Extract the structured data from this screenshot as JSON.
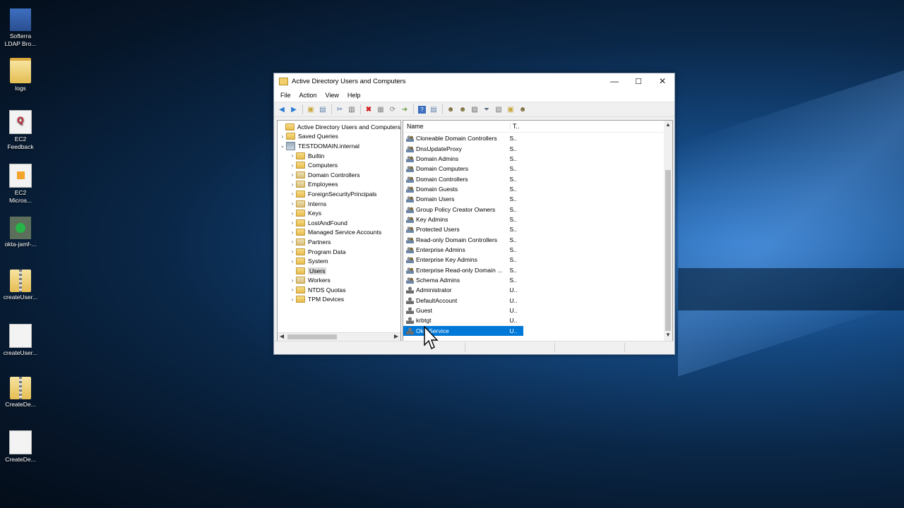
{
  "desktop_icons": [
    {
      "label": "Softerra LDAP Bro...",
      "icon": "ldap-browser-icon"
    },
    {
      "label": "logs",
      "icon": "folder-icon"
    },
    {
      "label": "EC2 Feedback",
      "icon": "feedback-icon"
    },
    {
      "label": "EC2 Micros...",
      "icon": "ec2-icon"
    },
    {
      "label": "okta-jamf-...",
      "icon": "okta-app-icon"
    },
    {
      "label": "createUser...",
      "icon": "zip-folder-icon"
    },
    {
      "label": "createUser...",
      "icon": "file-icon"
    },
    {
      "label": "CreateDe...",
      "icon": "zip-folder-icon"
    },
    {
      "label": "CreateDe...",
      "icon": "file-icon"
    }
  ],
  "window": {
    "title": "Active Directory Users and Computers",
    "minimize": "—",
    "maximize": "☐",
    "close": "✕"
  },
  "menu": [
    "File",
    "Action",
    "Help"
  ],
  "menu_full": {
    "file": "File",
    "action": "Action",
    "view": "View",
    "help": "Help"
  },
  "tree": {
    "root": "Active Directory Users and Computers",
    "saved_queries": "Saved Queries",
    "domain": "TESTDOMAIN.internal",
    "items": [
      "Builtin",
      "Computers",
      "Domain Controllers",
      "Employees",
      "ForeignSecurityPrincipals",
      "Interns",
      "Keys",
      "LostAndFound",
      "Managed Service Accounts",
      "Partners",
      "Program Data",
      "System",
      "Users",
      "Workers",
      "NTDS Quotas",
      "TPM Devices"
    ],
    "selected": "Users"
  },
  "list": {
    "col_name": "Name",
    "col_type": "T..",
    "rows": [
      {
        "name": "Cloneable Domain Controllers",
        "type": "S..",
        "kind": "group"
      },
      {
        "name": "DnsUpdateProxy",
        "type": "S..",
        "kind": "group"
      },
      {
        "name": "Domain Admins",
        "type": "S..",
        "kind": "group"
      },
      {
        "name": "Domain Computers",
        "type": "S..",
        "kind": "group"
      },
      {
        "name": "Domain Controllers",
        "type": "S..",
        "kind": "group"
      },
      {
        "name": "Domain Guests",
        "type": "S..",
        "kind": "group"
      },
      {
        "name": "Domain Users",
        "type": "S..",
        "kind": "group"
      },
      {
        "name": "Group Policy Creator Owners",
        "type": "S..",
        "kind": "group"
      },
      {
        "name": "Key Admins",
        "type": "S..",
        "kind": "group"
      },
      {
        "name": "Protected Users",
        "type": "S..",
        "kind": "group"
      },
      {
        "name": "Read-only Domain Controllers",
        "type": "S..",
        "kind": "group"
      },
      {
        "name": "Enterprise Admins",
        "type": "S..",
        "kind": "group"
      },
      {
        "name": "Enterprise Key Admins",
        "type": "S..",
        "kind": "group"
      },
      {
        "name": "Enterprise Read-only Domain ...",
        "type": "S..",
        "kind": "group"
      },
      {
        "name": "Schema Admins",
        "type": "S..",
        "kind": "group"
      },
      {
        "name": "Administrator",
        "type": "U..",
        "kind": "user"
      },
      {
        "name": "DefaultAccount",
        "type": "U..",
        "kind": "user"
      },
      {
        "name": "Guest",
        "type": "U..",
        "kind": "user"
      },
      {
        "name": "krbtgt",
        "type": "U..",
        "kind": "user"
      },
      {
        "name": "OktaService",
        "type": "U..",
        "kind": "user",
        "selected": true
      }
    ]
  },
  "colors": {
    "selection": "#0078d7",
    "window_border": "#7a8ea8"
  }
}
